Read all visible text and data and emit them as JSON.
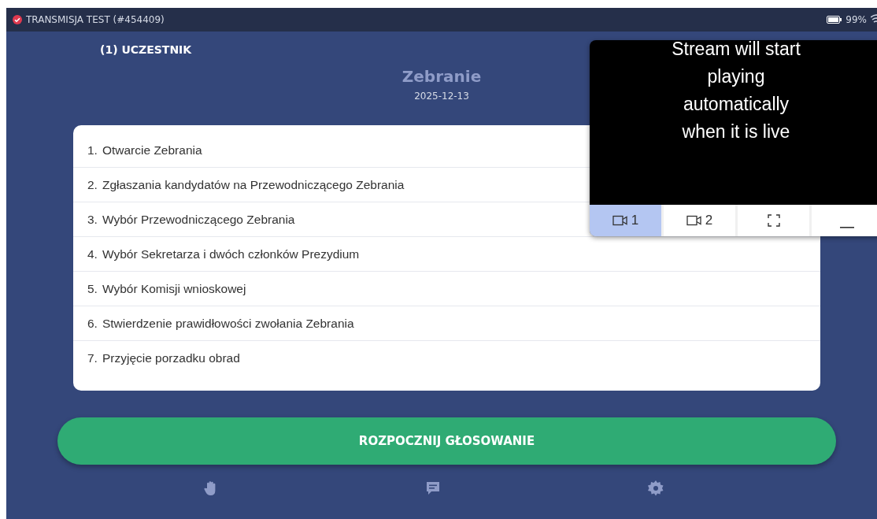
{
  "status_bar": {
    "title": "TRANSMISJA TEST (#454409)",
    "battery": "99%"
  },
  "participants": "(1) UCZESTNIK",
  "meeting": {
    "title": "Zebranie",
    "date": "2025-12-13"
  },
  "agenda": [
    {
      "number": "1.",
      "text": "Otwarcie Zebrania"
    },
    {
      "number": "2.",
      "text": "Zgłaszania kandydatów na Przewodniczącego Zebrania"
    },
    {
      "number": "3.",
      "text": "Wybór Przewodniczącego Zebrania"
    },
    {
      "number": "4.",
      "text": "Wybór Sekretarza i dwóch członków Prezydium"
    },
    {
      "number": "5.",
      "text": "Wybór Komisji wnioskowej"
    },
    {
      "number": "6.",
      "text": "Stwierdzenie prawidłowości zwołania Zebrania"
    },
    {
      "number": "7.",
      "text": "Przyjęcie porzadku obrad"
    }
  ],
  "vote_button": "ROZPOCZNIJ GŁOSOWANIE",
  "stream": {
    "message": "Stream will start playing automatically when it is live",
    "controls": [
      {
        "kind": "camera",
        "label": "1",
        "selected": true
      },
      {
        "kind": "camera",
        "label": "2",
        "selected": false
      },
      {
        "kind": "fullscreen",
        "selected": false
      },
      {
        "kind": "minimize",
        "selected": false
      }
    ]
  },
  "bottom_nav": [
    {
      "kind": "hand"
    },
    {
      "kind": "chat"
    },
    {
      "kind": "settings"
    }
  ]
}
